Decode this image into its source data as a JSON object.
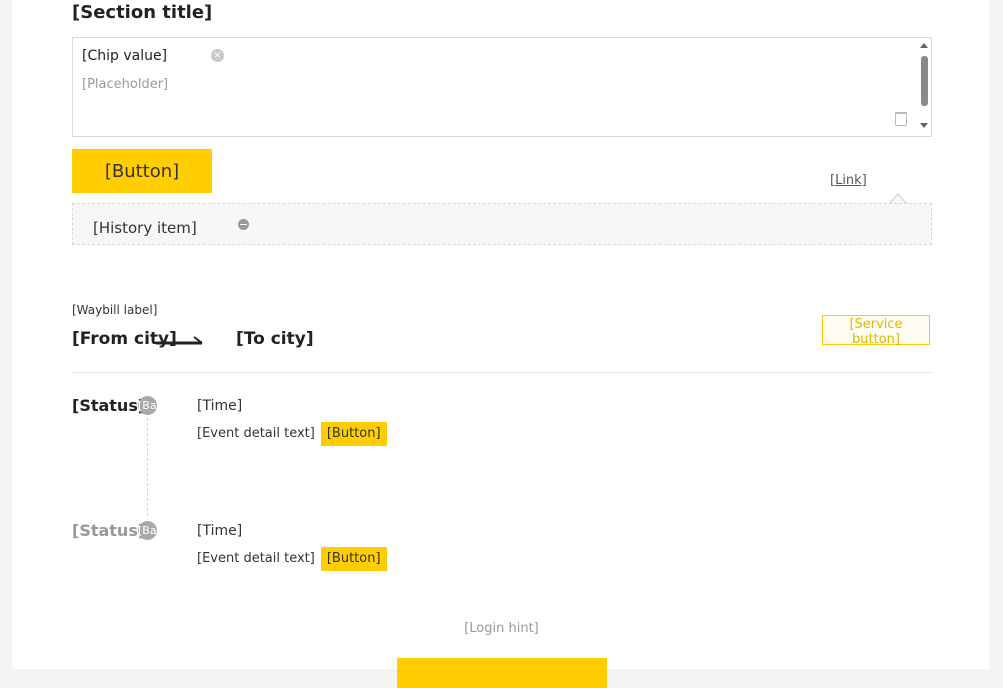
{
  "query": {
    "title": "[Section title]",
    "chip_value": "[Chip value]",
    "placeholder": "[Placeholder]",
    "button_label": "[Button]",
    "recent_link": "[Link]",
    "history": [
      "[History item]"
    ]
  },
  "shipment": {
    "waybill_label": "[Waybill label]",
    "from": "[From city]",
    "to": "[To city]",
    "service_button": "[Service button]"
  },
  "events": [
    {
      "status": "[Status]",
      "badge": "[Badge]",
      "time": "[Time]",
      "detail": "[Event detail text]",
      "correct_label": "[Button]"
    },
    {
      "status": "[Status]",
      "badge": "[Badge]",
      "time": "[Time]",
      "detail": "[Event detail text]",
      "correct_label": "[Button]"
    }
  ],
  "footer": {
    "login_hint": "[Login hint]"
  },
  "colors": {
    "accent": "#ffcd00",
    "background": "#f4f4f4",
    "muted_text": "#999999"
  },
  "icons": [
    "clear-icon",
    "scroll-up-icon",
    "scroll-down-icon",
    "trash-icon",
    "remove-icon",
    "arrow-right-icon"
  ]
}
